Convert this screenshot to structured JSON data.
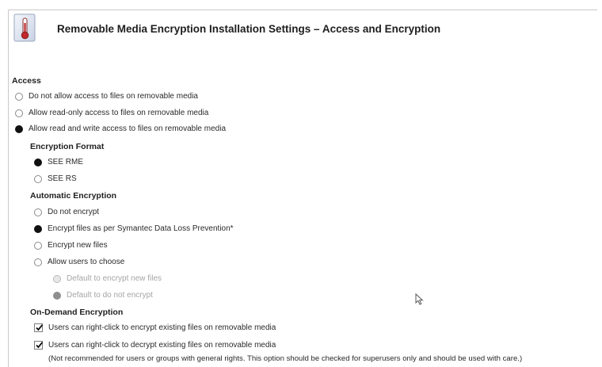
{
  "header": {
    "title": "Removable Media Encryption Installation Settings – Access and Encryption",
    "icon": "thermometer-settings-icon"
  },
  "access": {
    "title": "Access",
    "options": [
      {
        "label": "Do not allow access to files on removable media",
        "checked": false
      },
      {
        "label": "Allow read-only access to files on removable media",
        "checked": false
      },
      {
        "label": "Allow read and write access to files on removable media",
        "checked": true
      }
    ]
  },
  "encryption_format": {
    "title": "Encryption Format",
    "options": [
      {
        "label": "SEE RME",
        "checked": true
      },
      {
        "label": "SEE RS",
        "checked": false
      }
    ]
  },
  "automatic_encryption": {
    "title": "Automatic Encryption",
    "options": [
      {
        "label": "Do not encrypt",
        "checked": false
      },
      {
        "label": "Encrypt files as per Symantec Data Loss Prevention*",
        "checked": true
      },
      {
        "label": "Encrypt new files",
        "checked": false
      },
      {
        "label": "Allow users to choose",
        "checked": false
      }
    ],
    "sub_options": [
      {
        "label": "Default to encrypt new files",
        "checked": false,
        "disabled": true
      },
      {
        "label": "Default to do not encrypt",
        "checked": true,
        "disabled": true
      }
    ]
  },
  "on_demand": {
    "title": "On-Demand Encryption",
    "options": [
      {
        "label": "Users can right-click to encrypt existing files on removable media",
        "checked": true
      },
      {
        "label": "Users can right-click to decrypt existing files on removable media",
        "checked": true
      }
    ],
    "note": "(Not recommended for users or groups with general rights. This option should be checked for superusers only and should be used with care.)"
  }
}
